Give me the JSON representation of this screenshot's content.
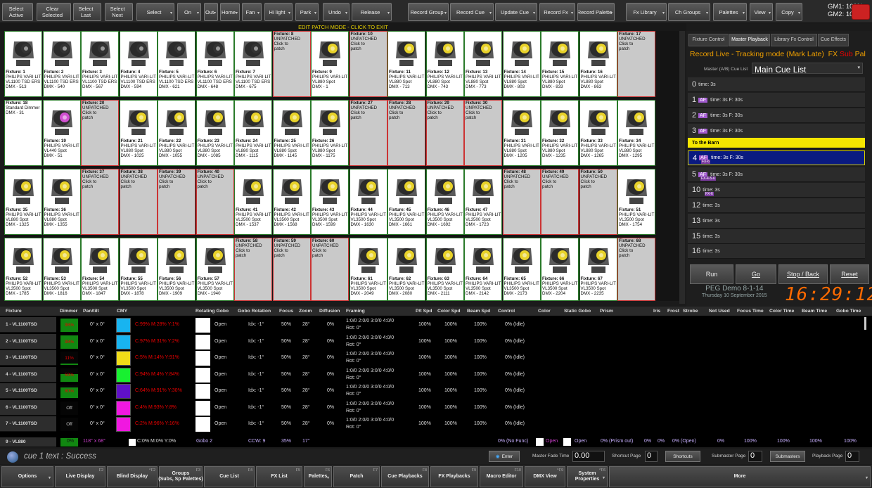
{
  "toolbar": {
    "buttons": [
      "Select\nActive",
      "Clear\nSelected",
      "Select\nLast",
      "Select\nNext",
      "Select",
      "On",
      "Out",
      "Home",
      "Fan",
      "Hi light",
      "Park",
      "Undo",
      "Release",
      "Record Group",
      "Record Cue",
      "Update Cue",
      "Record Fx",
      "Record Palette",
      "Fx Library",
      "Ch Groups",
      "Palettes",
      "View",
      "Copy"
    ],
    "gm1": "GM1: 100%",
    "gm2": "GM2: 100%"
  },
  "edit_banner": "EDIT PATCH MODE - CLICK TO EXIT",
  "fixtures": [
    [
      "Fixture: 1",
      "PHILIPS VARI-LIT",
      "VL1100 TSD ERS",
      "DMX - 513"
    ],
    [
      "Fixture: 2",
      "PHILIPS VARI-LIT",
      "VL1100 TSD ERS",
      "DMX - 540"
    ],
    [
      "Fixture: 3",
      "PHILIPS VARI-LIT",
      "VL1100 TSD ERS",
      "DMX - 567"
    ],
    [
      "Fixture: 4",
      "PHILIPS VARI-LIT",
      "VL1100 TSD ERS",
      "DMX - 594"
    ],
    [
      "Fixture: 5",
      "PHILIPS VARI-LIT",
      "VL1100 TSD ERS",
      "DMX - 621"
    ],
    [
      "Fixture: 6",
      "PHILIPS VARI-LIT",
      "VL1100 TSD ERS",
      "DMX - 648"
    ],
    [
      "Fixture: 7",
      "PHILIPS VARI-LIT",
      "VL1100 TSD ERS",
      "DMX - 675"
    ],
    [
      "Fixture: 8",
      "UNPATCHED",
      "Click to",
      "patch"
    ],
    [
      "Fixture: 9",
      "PHILIPS VARI-LIT",
      "VL880 Spot",
      "DMX - 1"
    ],
    [
      "Fixture: 10",
      "UNPATCHED",
      "Click to",
      "patch"
    ],
    [
      "Fixture: 11",
      "PHILIPS VARI-LIT",
      "VL880 Spot",
      "DMX - 713"
    ],
    [
      "Fixture: 12",
      "PHILIPS VARI-LIT",
      "VL880 Spot",
      "DMX - 743"
    ],
    [
      "Fixture: 13",
      "PHILIPS VARI-LIT",
      "VL880 Spot",
      "DMX - 773"
    ],
    [
      "Fixture: 14",
      "PHILIPS VARI-LIT",
      "VL880 Spot",
      "DMX - 803"
    ],
    [
      "Fixture: 15",
      "PHILIPS VARI-LIT",
      "VL880 Spot",
      "DMX - 833"
    ],
    [
      "Fixture: 16",
      "PHILIPS VARI-LIT",
      "VL880 Spot",
      "DMX - 863"
    ],
    [
      "Fixture: 17",
      "UNPATCHED",
      "Click to",
      "patch"
    ],
    [
      "Fixture: 18",
      "",
      "Standard Dimmer",
      "DMX - 31"
    ],
    [
      "Fixture: 19",
      "PHILIPS VARI-LIT",
      "VL440 Spot",
      "DMX - 51"
    ],
    [
      "Fixture: 20",
      "UNPATCHED",
      "Click to",
      "patch"
    ],
    [
      "Fixture: 21",
      "PHILIPS VARI-LIT",
      "VL880 Spot",
      "DMX - 1025"
    ],
    [
      "Fixture: 22",
      "PHILIPS VARI-LIT",
      "VL880 Spot",
      "DMX - 1055"
    ],
    [
      "Fixture: 23",
      "PHILIPS VARI-LIT",
      "VL880 Spot",
      "DMX - 1085"
    ],
    [
      "Fixture: 24",
      "PHILIPS VARI-LIT",
      "VL880 Spot",
      "DMX - 1115"
    ],
    [
      "Fixture: 25",
      "PHILIPS VARI-LIT",
      "VL880 Spot",
      "DMX - 1145"
    ],
    [
      "Fixture: 26",
      "PHILIPS VARI-LIT",
      "VL880 Spot",
      "DMX - 1175"
    ],
    [
      "Fixture: 27",
      "UNPATCHED",
      "Click to",
      "patch"
    ],
    [
      "Fixture: 28",
      "UNPATCHED",
      "Click to",
      "patch"
    ],
    [
      "Fixture: 29",
      "UNPATCHED",
      "Click to",
      "patch"
    ],
    [
      "Fixture: 30",
      "UNPATCHED",
      "Click to",
      "patch"
    ],
    [
      "Fixture: 31",
      "PHILIPS VARI-LIT",
      "VL880 Spot",
      "DMX - 1205"
    ],
    [
      "Fixture: 32",
      "PHILIPS VARI-LIT",
      "VL880 Spot",
      "DMX - 1235"
    ],
    [
      "Fixture: 33",
      "PHILIPS VARI-LIT",
      "VL880 Spot",
      "DMX - 1265"
    ],
    [
      "Fixture: 34",
      "PHILIPS VARI-LIT",
      "VL880 Spot",
      "DMX - 1295"
    ],
    [
      "Fixture: 35",
      "PHILIPS VARI-LIT",
      "VL880 Spot",
      "DMX - 1325"
    ],
    [
      "Fixture: 36",
      "PHILIPS VARI-LIT",
      "VL880 Spot",
      "DMX - 1355"
    ],
    [
      "Fixture: 37",
      "UNPATCHED",
      "Click to",
      "patch"
    ],
    [
      "Fixture: 38",
      "UNPATCHED",
      "Click to",
      "patch"
    ],
    [
      "Fixture: 39",
      "UNPATCHED",
      "Click to",
      "patch"
    ],
    [
      "Fixture: 40",
      "UNPATCHED",
      "Click to",
      "patch"
    ],
    [
      "Fixture: 41",
      "PHILIPS VARI-LIT",
      "VL3500 Spot",
      "DMX - 1537"
    ],
    [
      "Fixture: 42",
      "PHILIPS VARI-LIT",
      "VL3500 Spot",
      "DMX - 1568"
    ],
    [
      "Fixture: 43",
      "PHILIPS VARI-LIT",
      "VL3500 Spot",
      "DMX - 1599"
    ],
    [
      "Fixture: 44",
      "PHILIPS VARI-LIT",
      "VL3500 Spot",
      "DMX - 1630"
    ],
    [
      "Fixture: 45",
      "PHILIPS VARI-LIT",
      "VL3500 Spot",
      "DMX - 1661"
    ],
    [
      "Fixture: 46",
      "PHILIPS VARI-LIT",
      "VL3500 Spot",
      "DMX - 1692"
    ],
    [
      "Fixture: 47",
      "PHILIPS VARI-LIT",
      "VL3500 Spot",
      "DMX - 1723"
    ],
    [
      "Fixture: 48",
      "UNPATCHED",
      "Click to",
      "patch"
    ],
    [
      "Fixture: 49",
      "UNPATCHED",
      "Click to",
      "patch"
    ],
    [
      "Fixture: 50",
      "UNPATCHED",
      "Click to",
      "patch"
    ],
    [
      "Fixture: 51",
      "PHILIPS VARI-LIT",
      "VL3500 Spot",
      "DMX - 1754"
    ],
    [
      "Fixture: 52",
      "PHILIPS VARI-LIT",
      "VL3500 Spot",
      "DMX - 1785"
    ],
    [
      "Fixture: 53",
      "PHILIPS VARI-LIT",
      "VL3500 Spot",
      "DMX - 1816"
    ],
    [
      "Fixture: 54",
      "PHILIPS VARI-LIT",
      "VL3500 Spot",
      "DMX - 1847"
    ],
    [
      "Fixture: 55",
      "PHILIPS VARI-LIT",
      "VL3500 Spot",
      "DMX - 1878"
    ],
    [
      "Fixture: 56",
      "PHILIPS VARI-LIT",
      "VL3500 Spot",
      "DMX - 1909"
    ],
    [
      "Fixture: 57",
      "PHILIPS VARI-LIT",
      "VL3500 Spot",
      "DMX - 1940"
    ],
    [
      "Fixture: 58",
      "UNPATCHED",
      "Click to",
      "patch"
    ],
    [
      "Fixture: 59",
      "UNPATCHED",
      "Click to",
      "patch"
    ],
    [
      "Fixture: 60",
      "UNPATCHED",
      "Click to",
      "patch"
    ],
    [
      "Fixture: 61",
      "PHILIPS VARI-LIT",
      "VL3500 Spot",
      "DMX - 2049"
    ],
    [
      "Fixture: 62",
      "PHILIPS VARI-LIT",
      "VL3500 Spot",
      "DMX - 2080"
    ],
    [
      "Fixture: 63",
      "PHILIPS VARI-LIT",
      "VL3500 Spot",
      "DMX - 2111"
    ],
    [
      "Fixture: 64",
      "PHILIPS VARI-LIT",
      "VL3500 Spot",
      "DMX - 2142"
    ],
    [
      "Fixture: 65",
      "PHILIPS VARI-LIT",
      "VL3500 Spot",
      "DMX - 2173"
    ],
    [
      "Fixture: 66",
      "PHILIPS VARI-LIT",
      "VL3500 Spot",
      "DMX - 2204"
    ],
    [
      "Fixture: 67",
      "PHILIPS VARI-LIT",
      "VL3500 Spot",
      "DMX - 2235"
    ],
    [
      "Fixture: 68",
      "UNPATCHED",
      "Click to",
      "patch"
    ]
  ],
  "right": {
    "tabs": [
      "Fixture Control",
      "Master Playback",
      "Library Fx Control",
      "Cue Effects"
    ],
    "mode": "Record Live - Tracking mode (Mark Late)",
    "fx": "FX",
    "sub": "Sub",
    "pal": "Pal",
    "cuelist_label": "Master (A/B) Cue List",
    "cuelist": "Main Cue List",
    "cues": [
      {
        "n": "0",
        "af": "",
        "t": "time: 3s",
        "fx": ""
      },
      {
        "n": "1",
        "af": "AF",
        "t": "time: 3s F: 30s",
        "fx": ""
      },
      {
        "n": "2",
        "af": "AF",
        "t": "time: 3s F: 30s",
        "fx": ""
      },
      {
        "n": "3",
        "af": "AF",
        "t": "time: 3s F: 30s",
        "fx": ""
      },
      {
        "n": "",
        "af": "",
        "t": "To the Barn",
        "fx": ""
      },
      {
        "n": "4",
        "af": "AF",
        "t": "time: 3s F: 30s",
        "fx": "FX-6"
      },
      {
        "n": "5",
        "af": "AF",
        "t": "time: 3s F: 30s",
        "fx": "FX-4-5-6"
      },
      {
        "n": "10",
        "af": "",
        "t": "time: 3s",
        "fx": "FX-6"
      },
      {
        "n": "12",
        "af": "",
        "t": "time: 3s",
        "fx": ""
      },
      {
        "n": "13",
        "af": "",
        "t": "time: 3s",
        "fx": ""
      },
      {
        "n": "15",
        "af": "",
        "t": "time: 3s",
        "fx": ""
      },
      {
        "n": "16",
        "af": "",
        "t": "time: 3s",
        "fx": ""
      }
    ],
    "run": "Run",
    "go": "Go",
    "stop": "Stop / Back",
    "reset": "Reset",
    "show": "PEG Demo 8-1-14",
    "date": "Thursday 10 September  2015",
    "clock": "16:29:12"
  },
  "table": {
    "headers": [
      "Fixture",
      "Dimmer",
      "Pan/tilt",
      "CMY",
      "Rotating Gobo",
      "Gobo Rotation",
      "Focus",
      "Zoom",
      "Diffusion",
      "Framing",
      "P/t Spd",
      "Color Spd",
      "Beam Spd",
      "Control",
      "Color",
      "Static Gobo",
      "Prism",
      "Iris",
      "Frost",
      "Strobe",
      "Not Used",
      "Focus Time",
      "Color Time",
      "Beam Time",
      "Gobo Time"
    ],
    "rows": [
      {
        "name": "1 - VL1100TSD",
        "dim": "98%",
        "dimv": 0.98,
        "pt": "0° x 0°",
        "cmyc": "#18b4f0",
        "cmy": "C:99% M:28% Y:1%",
        "gobo": "Open",
        "rot": "Idx: -1°",
        "focus": "50%",
        "zoom": "28°",
        "diff": "0%",
        "fr1": "1:0/0 2:0/0 3:0/0 4:0/0",
        "fr2": "Rot: 0°",
        "pts": "100%",
        "cs": "100%",
        "bs": "100%",
        "ctl": "0% (Idle)"
      },
      {
        "name": "2 - VL1100TSD",
        "dim": "98%",
        "dimv": 0.98,
        "pt": "0° x 0°",
        "cmyc": "#18b4f0",
        "cmy": "C:97% M:31% Y:2%",
        "gobo": "Open",
        "rot": "Idx: -1°",
        "focus": "50%",
        "zoom": "28°",
        "diff": "0%",
        "fr1": "1:0/0 2:0/0 3:0/0 4:0/0",
        "fr2": "Rot: 0°",
        "pts": "100%",
        "cs": "100%",
        "bs": "100%",
        "ctl": "0% (Idle)"
      },
      {
        "name": "3 - VL1100TSD",
        "dim": "11%",
        "dimv": 0.11,
        "pt": "0° x 0°",
        "cmyc": "#f0dc18",
        "cmy": "C:5% M:14% Y:91%",
        "gobo": "Open",
        "rot": "Idx: -1°",
        "focus": "50%",
        "zoom": "28°",
        "diff": "0%",
        "fr1": "1:0/0 2:0/0 3:0/0 4:0/0",
        "fr2": "Rot: 0°",
        "pts": "100%",
        "cs": "100%",
        "bs": "100%",
        "ctl": "0% (Idle)"
      },
      {
        "name": "4 - VL1100TSD",
        "dim": "59%",
        "dimv": 0.59,
        "pt": "0° x 0°",
        "cmyc": "#18f030",
        "cmy": "C:94% M:4% Y:84%",
        "gobo": "Open",
        "rot": "Idx: -1°",
        "focus": "50%",
        "zoom": "28°",
        "diff": "0%",
        "fr1": "1:0/0 2:0/0 3:0/0 4:0/0",
        "fr2": "Rot: 0°",
        "pts": "100%",
        "cs": "100%",
        "bs": "100%",
        "ctl": "0% (Idle)"
      },
      {
        "name": "5 - VL1100TSD",
        "dim": "80%",
        "dimv": 0.8,
        "pt": "0° x 0°",
        "cmyc": "#6010c8",
        "cmy": "C:64% M:91% Y:30%",
        "gobo": "Open",
        "rot": "Idx: -1°",
        "focus": "50%",
        "zoom": "28°",
        "diff": "0%",
        "fr1": "1:0/0 2:0/0 3:0/0 4:0/0",
        "fr2": "Rot: 0°",
        "pts": "100%",
        "cs": "100%",
        "bs": "100%",
        "ctl": "0% (Idle)"
      },
      {
        "name": "6 - VL1100TSD",
        "dim": "Off",
        "dimv": 0,
        "pt": "0° x 0°",
        "cmyc": "#f018e0",
        "cmy": "C:4% M:93% Y:8%",
        "gobo": "Open",
        "rot": "Idx: -1°",
        "focus": "50%",
        "zoom": "28°",
        "diff": "0%",
        "fr1": "1:0/0 2:0/0 3:0/0 4:0/0",
        "fr2": "Rot: 0°",
        "pts": "100%",
        "cs": "100%",
        "bs": "100%",
        "ctl": "0% (Idle)"
      },
      {
        "name": "7 - VL1100TSD",
        "dim": "Off",
        "dimv": 0,
        "pt": "0° x 0°",
        "cmyc": "#f018e0",
        "cmy": "C:2% M:96% Y:16%",
        "gobo": "Open",
        "rot": "Idx: -1°",
        "focus": "50%",
        "zoom": "28°",
        "diff": "0%",
        "fr1": "1:0/0 2:0/0 3:0/0 4:0/0",
        "fr2": "Rot: 0°",
        "pts": "100%",
        "cs": "100%",
        "bs": "100%",
        "ctl": "0% (Idle)"
      }
    ],
    "last": {
      "name": "9 - VL880",
      "dim": "0%",
      "pt": "118° x 68°",
      "cmy": "C:0% M:0% Y:0%",
      "gobo": "Gobo 2",
      "rot": "CCW: 9",
      "focus": "35%",
      "zoom": "17°",
      "ctl": "0% (No Func)",
      "color": "Open",
      "sgobo": "Open",
      "prism": "0% (Prism out)",
      "iris": "0%",
      "frost": "0%",
      "strobe": "0% (Open)",
      "nu": "0%",
      "ft": "100%",
      "ct": "100%",
      "bt": "100%",
      "gt": "100%"
    }
  },
  "status": {
    "text": "cue 1 text  : Success",
    "enter": "Enter",
    "mft_label": "Master Fade Time",
    "mft": "0.00",
    "scp_label": "Shortcut Page",
    "scp": "0",
    "shortcuts": "Shortcuts",
    "smp_label": "Submaster Page",
    "smp": "0",
    "submasters": "Submasters",
    "pbp_label": "Playback Page",
    "pbp": "0"
  },
  "fkeys": [
    {
      "l": "Options",
      "k": ""
    },
    {
      "l": "Live Display",
      "k": "F2"
    },
    {
      "l": "Blind Display",
      "k": "^F2"
    },
    {
      "l": "Groups\n(Subs, Sp Palettes)",
      "k": "F3"
    },
    {
      "l": "Cue List",
      "k": "F4"
    },
    {
      "l": "FX List",
      "k": "F5"
    },
    {
      "l": "Palettes",
      "k": "F6"
    },
    {
      "l": "Patch",
      "k": "F7"
    },
    {
      "l": "Cue Playbacks",
      "k": "F8"
    },
    {
      "l": "FX Playbacks",
      "k": "F9"
    },
    {
      "l": "Macro Editor",
      "k": "F10"
    },
    {
      "l": "DMX View",
      "k": "^F9"
    },
    {
      "l": "System\nProperties",
      "k": "^F6"
    },
    {
      "l": "More",
      "k": ""
    }
  ]
}
